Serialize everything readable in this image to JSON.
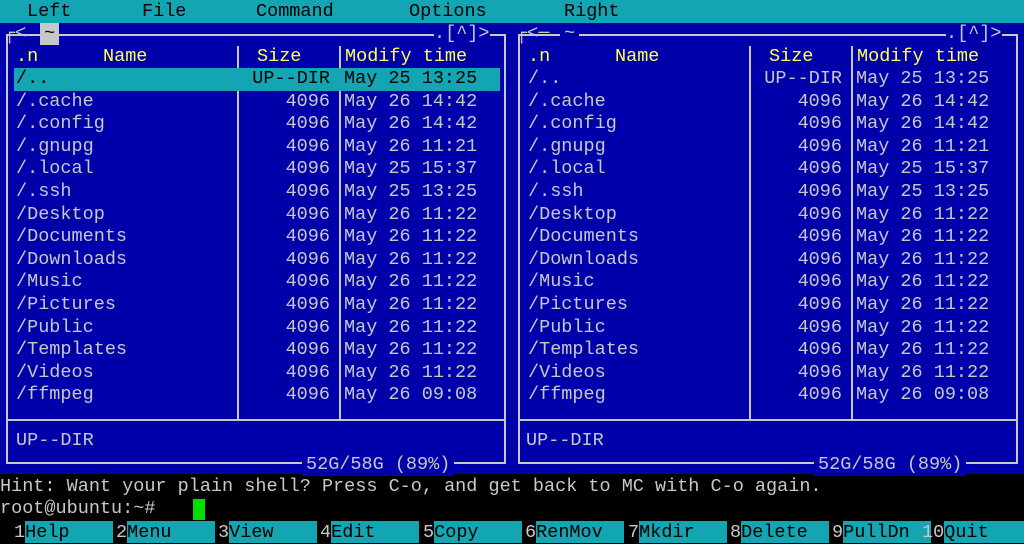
{
  "menubar": {
    "items": [
      {
        "label": "Left"
      },
      {
        "label": "File"
      },
      {
        "label": "Command"
      },
      {
        "label": "Options"
      },
      {
        "label": "Right"
      }
    ]
  },
  "left_panel": {
    "path": "~",
    "controls": ".[^]>",
    "columns": {
      "name_prefix": ".n",
      "name": "Name",
      "size": "Size",
      "time": "Modify time"
    },
    "files": [
      {
        "name": "/..",
        "size": "UP--DIR",
        "time": "May 25 13:25"
      },
      {
        "name": "/.cache",
        "size": "4096",
        "time": "May 26 14:42"
      },
      {
        "name": "/.config",
        "size": "4096",
        "time": "May 26 14:42"
      },
      {
        "name": "/.gnupg",
        "size": "4096",
        "time": "May 26 11:21"
      },
      {
        "name": "/.local",
        "size": "4096",
        "time": "May 25 15:37"
      },
      {
        "name": "/.ssh",
        "size": "4096",
        "time": "May 25 13:25"
      },
      {
        "name": "/Desktop",
        "size": "4096",
        "time": "May 26 11:22"
      },
      {
        "name": "/Documents",
        "size": "4096",
        "time": "May 26 11:22"
      },
      {
        "name": "/Downloads",
        "size": "4096",
        "time": "May 26 11:22"
      },
      {
        "name": "/Music",
        "size": "4096",
        "time": "May 26 11:22"
      },
      {
        "name": "/Pictures",
        "size": "4096",
        "time": "May 26 11:22"
      },
      {
        "name": "/Public",
        "size": "4096",
        "time": "May 26 11:22"
      },
      {
        "name": "/Templates",
        "size": "4096",
        "time": "May 26 11:22"
      },
      {
        "name": "/Videos",
        "size": "4096",
        "time": "May 26 11:22"
      },
      {
        "name": "/ffmpeg",
        "size": "4096",
        "time": "May 26 09:08"
      }
    ],
    "status": "UP--DIR",
    "disk": "52G/58G (89%)"
  },
  "right_panel": {
    "path": "~",
    "controls": ".[^]>",
    "columns": {
      "name_prefix": ".n",
      "name": "Name",
      "size": "Size",
      "time": "Modify time"
    },
    "files": [
      {
        "name": "/..",
        "size": "UP--DIR",
        "time": "May 25 13:25"
      },
      {
        "name": "/.cache",
        "size": "4096",
        "time": "May 26 14:42"
      },
      {
        "name": "/.config",
        "size": "4096",
        "time": "May 26 14:42"
      },
      {
        "name": "/.gnupg",
        "size": "4096",
        "time": "May 26 11:21"
      },
      {
        "name": "/.local",
        "size": "4096",
        "time": "May 25 15:37"
      },
      {
        "name": "/.ssh",
        "size": "4096",
        "time": "May 25 13:25"
      },
      {
        "name": "/Desktop",
        "size": "4096",
        "time": "May 26 11:22"
      },
      {
        "name": "/Documents",
        "size": "4096",
        "time": "May 26 11:22"
      },
      {
        "name": "/Downloads",
        "size": "4096",
        "time": "May 26 11:22"
      },
      {
        "name": "/Music",
        "size": "4096",
        "time": "May 26 11:22"
      },
      {
        "name": "/Pictures",
        "size": "4096",
        "time": "May 26 11:22"
      },
      {
        "name": "/Public",
        "size": "4096",
        "time": "May 26 11:22"
      },
      {
        "name": "/Templates",
        "size": "4096",
        "time": "May 26 11:22"
      },
      {
        "name": "/Videos",
        "size": "4096",
        "time": "May 26 11:22"
      },
      {
        "name": "/ffmpeg",
        "size": "4096",
        "time": "May 26 09:08"
      }
    ],
    "status": "UP--DIR",
    "disk": "52G/58G (89%)"
  },
  "hint": "Hint: Want your plain shell? Press C-o, and get back to MC with C-o again.",
  "prompt": "root@ubuntu:~#",
  "fkeys": [
    {
      "num": "1",
      "label": "Help"
    },
    {
      "num": "2",
      "label": "Menu"
    },
    {
      "num": "3",
      "label": "View"
    },
    {
      "num": "4",
      "label": "Edit"
    },
    {
      "num": "5",
      "label": "Copy"
    },
    {
      "num": "6",
      "label": "RenMov"
    },
    {
      "num": "7",
      "label": "Mkdir"
    },
    {
      "num": "8",
      "label": "Delete"
    },
    {
      "num": "9",
      "label": "PullDn"
    },
    {
      "num": "10",
      "label": "Quit"
    }
  ],
  "colors": {
    "panel_bg": "#0000aa",
    "accent_cyan": "#13a6b2",
    "header_yellow": "#ffff55",
    "text_gray": "#c8c8c8",
    "cursor_green": "#00e000"
  }
}
